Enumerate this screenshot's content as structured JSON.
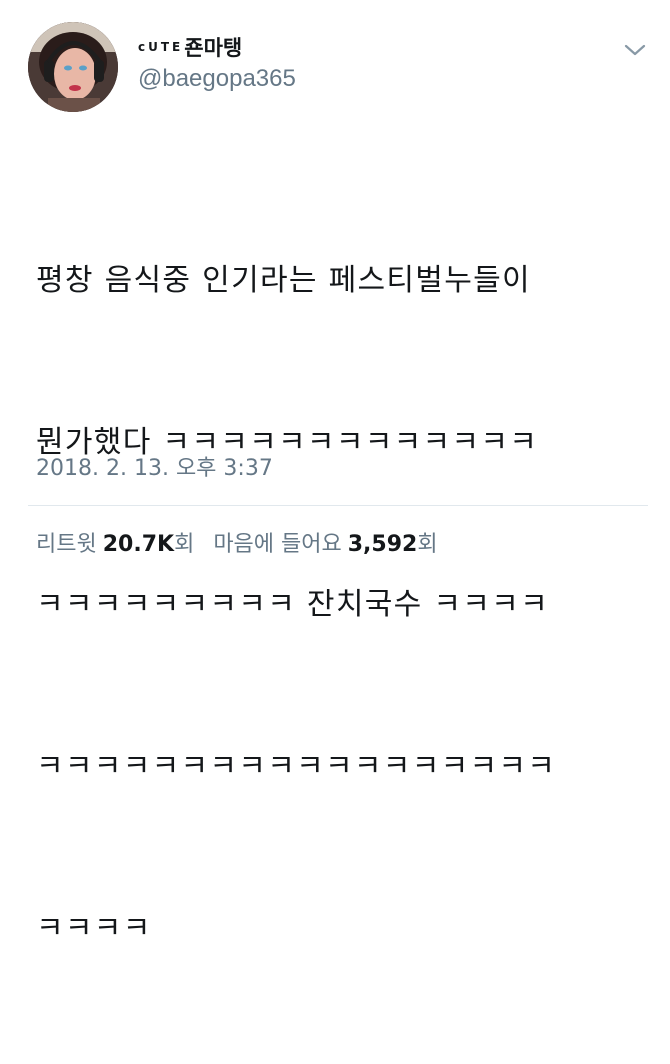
{
  "user": {
    "display_prefix": "cUTE",
    "display_name": "죤마탱",
    "handle": "@baegopa365"
  },
  "tweet": {
    "lines": [
      "평창 음식중 인기라는 페스티벌누들이",
      "뭔가했다 ㅋㅋㅋㅋㅋㅋㅋㅋㅋㅋㅋㅋㅋ",
      "ㅋㅋㅋㅋㅋㅋㅋㅋㅋ 잔치국수 ㅋㅋㅋㅋ",
      "ㅋㅋㅋㅋㅋㅋㅋㅋㅋㅋㅋㅋㅋㅋㅋㅋㅋㅋ",
      "ㅋㅋㅋㅋ"
    ],
    "timestamp": "2018. 2. 13. 오후 3:37"
  },
  "stats": {
    "retweets_label": "리트윗",
    "retweets_count": "20.7K",
    "retweets_unit": "회",
    "likes_label": "마음에 들어요",
    "likes_count": "3,592",
    "likes_unit": "회"
  },
  "icons": {
    "menu": "chevron-down-icon"
  },
  "colors": {
    "text": "#14171a",
    "secondary": "#657786",
    "divider": "#e1e8ed"
  }
}
